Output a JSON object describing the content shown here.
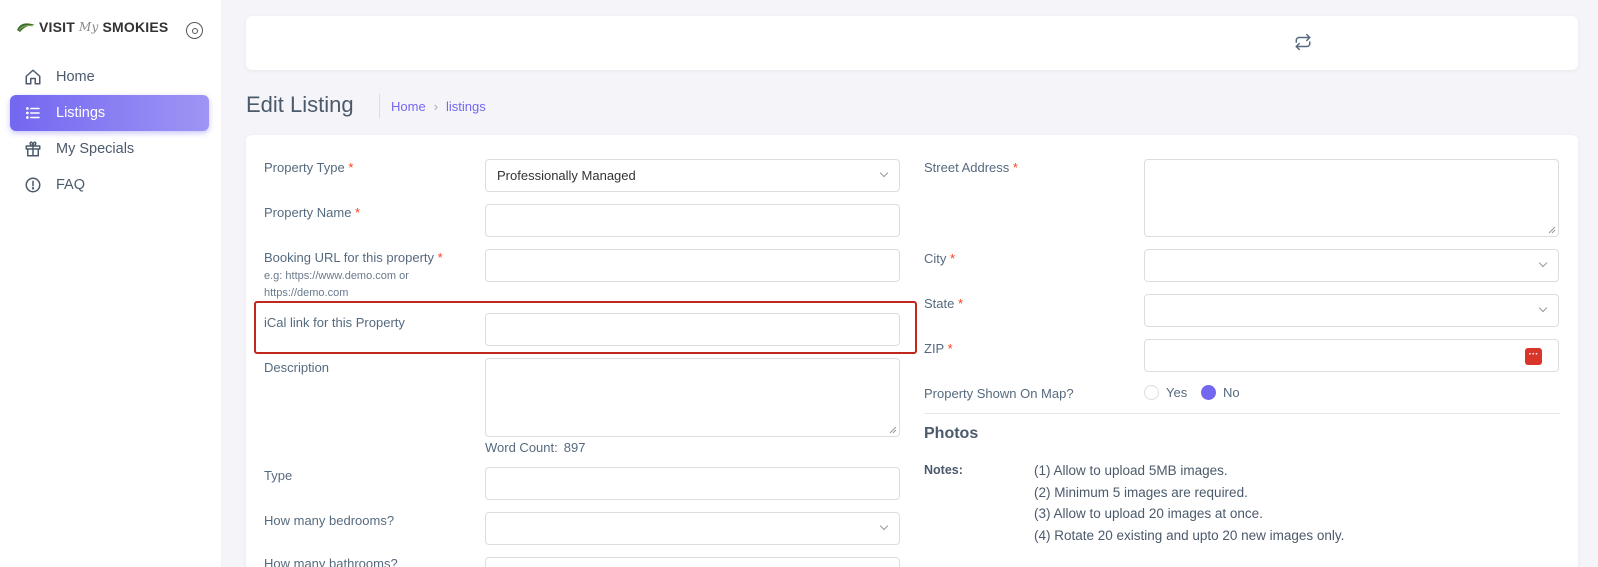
{
  "brand": {
    "left": "VISIT",
    "script": "My",
    "right": "SMOKIES"
  },
  "sidebar": {
    "items": [
      {
        "label": "Home",
        "icon": "home-icon",
        "active": false
      },
      {
        "label": "Listings",
        "icon": "list-icon",
        "active": true
      },
      {
        "label": "My Specials",
        "icon": "gift-icon",
        "active": false
      },
      {
        "label": "FAQ",
        "icon": "info-circle-icon",
        "active": false
      }
    ]
  },
  "header": {
    "title": "Edit Listing",
    "breadcrumb": [
      "Home",
      "listings"
    ]
  },
  "form_left": {
    "property_type": {
      "label": "Property Type",
      "value": "Professionally Managed"
    },
    "property_name": {
      "label": "Property Name",
      "value": ""
    },
    "booking_url": {
      "label": "Booking URL for this property",
      "hint_1": "e.g: https://www.demo.com or",
      "hint_2": "https://demo.com",
      "value": ""
    },
    "ical_link": {
      "label": "iCal link for this Property",
      "value": ""
    },
    "description": {
      "label": "Description",
      "word_count_label": "Word Count:",
      "word_count": "897"
    },
    "type": {
      "label": "Type",
      "value": ""
    },
    "bedrooms": {
      "label": "How many bedrooms?",
      "value": ""
    },
    "bathrooms": {
      "label": "How many bathrooms?"
    }
  },
  "form_right": {
    "street": {
      "label": "Street Address"
    },
    "city": {
      "label": "City"
    },
    "state": {
      "label": "State"
    },
    "zip": {
      "label": "ZIP"
    },
    "shown_on_map": {
      "label": "Property Shown On Map?",
      "yes": "Yes",
      "no": "No",
      "selected": "No"
    },
    "photos": {
      "title": "Photos",
      "notes_label": "Notes:",
      "notes": [
        "(1) Allow to upload 5MB images.",
        "(2) Minimum 5 images are required.",
        "(3) Allow to upload 20 images at once.",
        "(4) Rotate 20 existing and upto 20 new images only."
      ]
    }
  },
  "required_mark": "*",
  "colors": {
    "accent": "#7367f0",
    "required": "#ff3e1d",
    "highlight": "#c0281e"
  }
}
